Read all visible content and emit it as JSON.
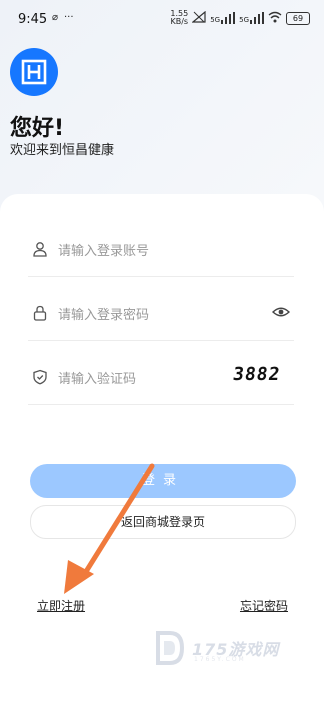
{
  "status_bar": {
    "time": "9:45",
    "indicator": "⌀",
    "more": "···",
    "speed_value": "1.55",
    "speed_unit": "KB/s",
    "network_1": "5G",
    "network_2": "5G",
    "battery": "69"
  },
  "header": {
    "greeting": "您好!",
    "welcome": "欢迎来到恒昌健康"
  },
  "form": {
    "account_placeholder": "请输入登录账号",
    "password_placeholder": "请输入登录密码",
    "captcha_placeholder": "请输入验证码",
    "captcha_code": "3882"
  },
  "buttons": {
    "login": "登录",
    "back_to_mall": "返回商城登录页"
  },
  "links": {
    "register": "立即注册",
    "forgot_password": "忘记密码"
  },
  "watermark": {
    "text": "175游戏网",
    "sub": "1765Y.COM"
  },
  "colors": {
    "brand": "#1677ff",
    "login_button": "#9cc8ff",
    "annotation_arrow": "#f07a3c"
  }
}
